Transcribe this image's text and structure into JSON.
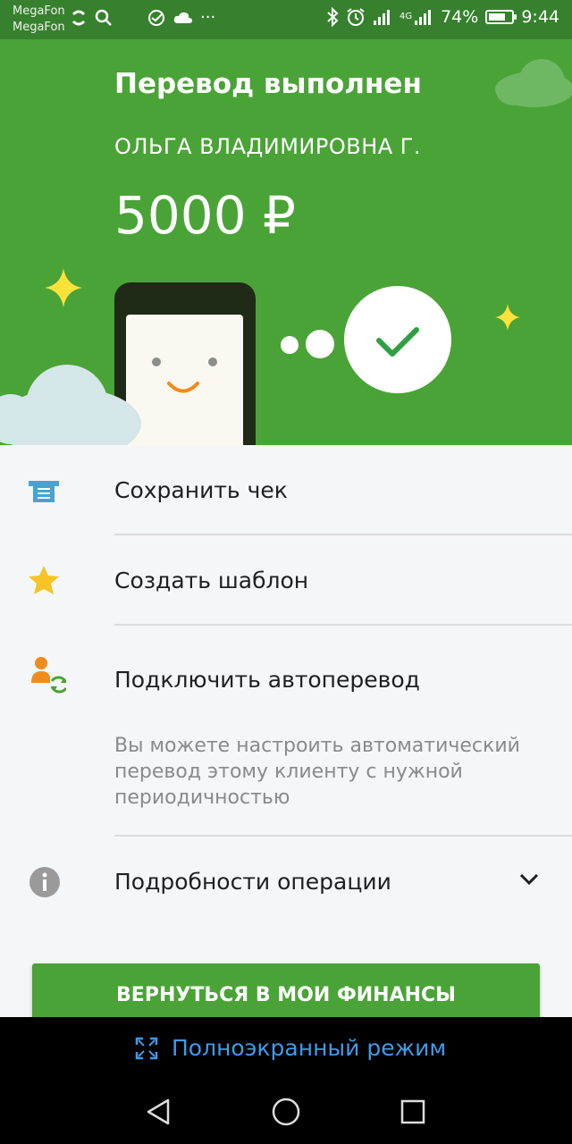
{
  "status_bar": {
    "carrier_1": "MegaFon",
    "carrier_2": "MegaFon",
    "battery_percent": "74%",
    "battery_level": 0.74,
    "time": "9:44",
    "network": "4G"
  },
  "header": {
    "title": "Перевод выполнен",
    "recipient": "ОЛЬГА ВЛАДИМИРОВНА Г.",
    "amount": "5000 ₽"
  },
  "menu": {
    "items": [
      {
        "label": "Сохранить чек",
        "icon": "receipt-icon"
      },
      {
        "label": "Создать шаблон",
        "icon": "star-icon"
      },
      {
        "label": "Подключить автоперевод",
        "icon": "person-repeat-icon",
        "description": "Вы можете настроить автоматический перевод этому клиенту с нужной периодичностью"
      },
      {
        "label": "Подробности операции",
        "icon": "info-icon"
      }
    ]
  },
  "cta": {
    "label": "ВЕРНУТЬСЯ В МОИ ФИНАНСЫ"
  },
  "bottom_bar": {
    "fullscreen_label": "Полноэкранный режим"
  },
  "colors": {
    "brand_green": "#4aa336",
    "status_green": "#37812e",
    "link_blue": "#3e9bea",
    "star_yellow": "#f7c325",
    "icon_orange": "#f08c1b"
  }
}
